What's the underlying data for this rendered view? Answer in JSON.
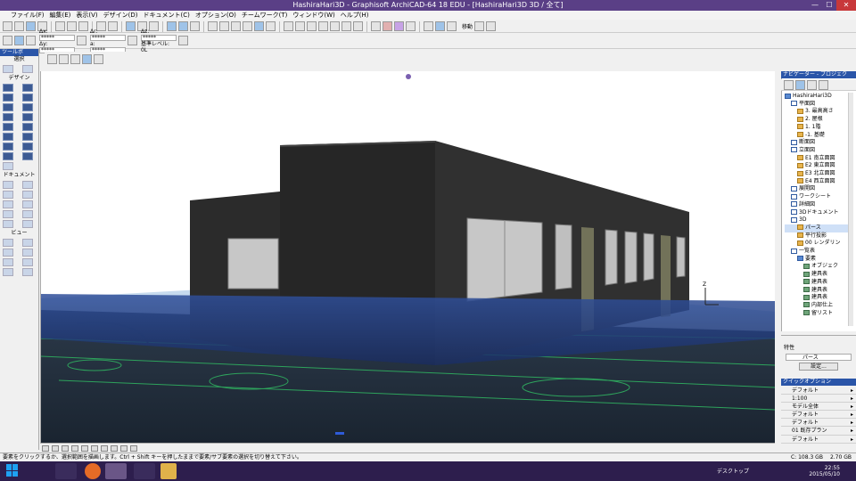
{
  "window": {
    "title": "HashiraHari3D - Graphisoft ArchiCAD-64 18 EDU - [HashiraHari3D 3D / 全て]",
    "min": "—",
    "max": "☐",
    "close": "✕"
  },
  "menu": [
    "ファイル(F)",
    "編集(E)",
    "表示(V)",
    "デザイン(D)",
    "ドキュメント(C)",
    "オプション(O)",
    "チームワーク(T)",
    "ウィンドウ(W)",
    "ヘルプ(H)"
  ],
  "toolbar": {
    "dx_label": "Δx:",
    "dx_value": "*****",
    "dy_label": "Δy:",
    "dy_value": "*****",
    "dr_label": "Δr:",
    "dr_value": "*****",
    "da_label": "a:",
    "da_value": "*****",
    "dz_label": "Δz:",
    "dz_value": "*****",
    "level_label": "基準レベル:",
    "level_value": "0L",
    "move_label": "移動"
  },
  "toolbox": {
    "title": "ツールボ",
    "select_label": "選択",
    "design_label": "デザイン",
    "document_label": "ドキュメント",
    "view_label": "ビュー"
  },
  "navigator": {
    "title": "ナビゲーター - プロジェク",
    "tree": [
      {
        "label": "HashiraHari3D",
        "level": 0,
        "icon": "blue"
      },
      {
        "label": "平面図",
        "level": 1,
        "icon": "view"
      },
      {
        "label": "3. 最高高さ",
        "level": 2,
        "icon": "folder"
      },
      {
        "label": "2. 屋根",
        "level": 2,
        "icon": "folder"
      },
      {
        "label": "1. 1階",
        "level": 2,
        "icon": "folder"
      },
      {
        "label": "-1. 基礎",
        "level": 2,
        "icon": "folder"
      },
      {
        "label": "断面図",
        "level": 1,
        "icon": "view"
      },
      {
        "label": "立面図",
        "level": 1,
        "icon": "view"
      },
      {
        "label": "E1 南立面図",
        "level": 2,
        "icon": "folder"
      },
      {
        "label": "E2 東立面図",
        "level": 2,
        "icon": "folder"
      },
      {
        "label": "E3 北立面図",
        "level": 2,
        "icon": "folder"
      },
      {
        "label": "E4 西立面図",
        "level": 2,
        "icon": "folder"
      },
      {
        "label": "展開図",
        "level": 1,
        "icon": "view"
      },
      {
        "label": "ワークシート",
        "level": 1,
        "icon": "view"
      },
      {
        "label": "詳細図",
        "level": 1,
        "icon": "view"
      },
      {
        "label": "3Dドキュメント",
        "level": 1,
        "icon": "view"
      },
      {
        "label": "3D",
        "level": 1,
        "icon": "view"
      },
      {
        "label": "パース",
        "level": 2,
        "icon": "folder"
      },
      {
        "label": "平行投影",
        "level": 2,
        "icon": "folder"
      },
      {
        "label": "00 レンダリン",
        "level": 2,
        "icon": "folder"
      },
      {
        "label": "一覧表",
        "level": 1,
        "icon": "view"
      },
      {
        "label": "要素",
        "level": 2,
        "icon": "blue"
      },
      {
        "label": "オブジェク",
        "level": 3,
        "icon": "green"
      },
      {
        "label": "建具表",
        "level": 3,
        "icon": "green"
      },
      {
        "label": "建具表",
        "level": 3,
        "icon": "green"
      },
      {
        "label": "建具表",
        "level": 3,
        "icon": "green"
      },
      {
        "label": "建具表",
        "level": 3,
        "icon": "green"
      },
      {
        "label": "内部仕上",
        "level": 3,
        "icon": "green"
      },
      {
        "label": "留リスト",
        "level": 3,
        "icon": "green"
      }
    ]
  },
  "properties": {
    "title": "特性",
    "field_value": "パース",
    "settings_button": "設定..."
  },
  "quick_options": {
    "title": "クイックオプション",
    "items": [
      "デフォルト",
      "1:100",
      "モデル全体",
      "デフォルト",
      "デフォルト",
      "01 既存プラン",
      "デフォルト"
    ]
  },
  "status": {
    "message": "要素をクリックするか、選択範囲を描画します。Ctrl + Shift キーを押したままで要素/サブ要素の選択を切り替えて下さい。",
    "disk": "C: 108.3 GB",
    "ram": "2.70 GB"
  },
  "taskbar": {
    "time": "22:55",
    "date": "2015/05/10",
    "desktop_label": "デスクトップ"
  },
  "model": {
    "z_axis_label": "Z"
  },
  "colors": {
    "accent": "#2a55a8",
    "title": "#5a3f86",
    "taskbar": "#2d1e4d",
    "building": "#2b2b2b",
    "ground": "#1e2c3a"
  }
}
